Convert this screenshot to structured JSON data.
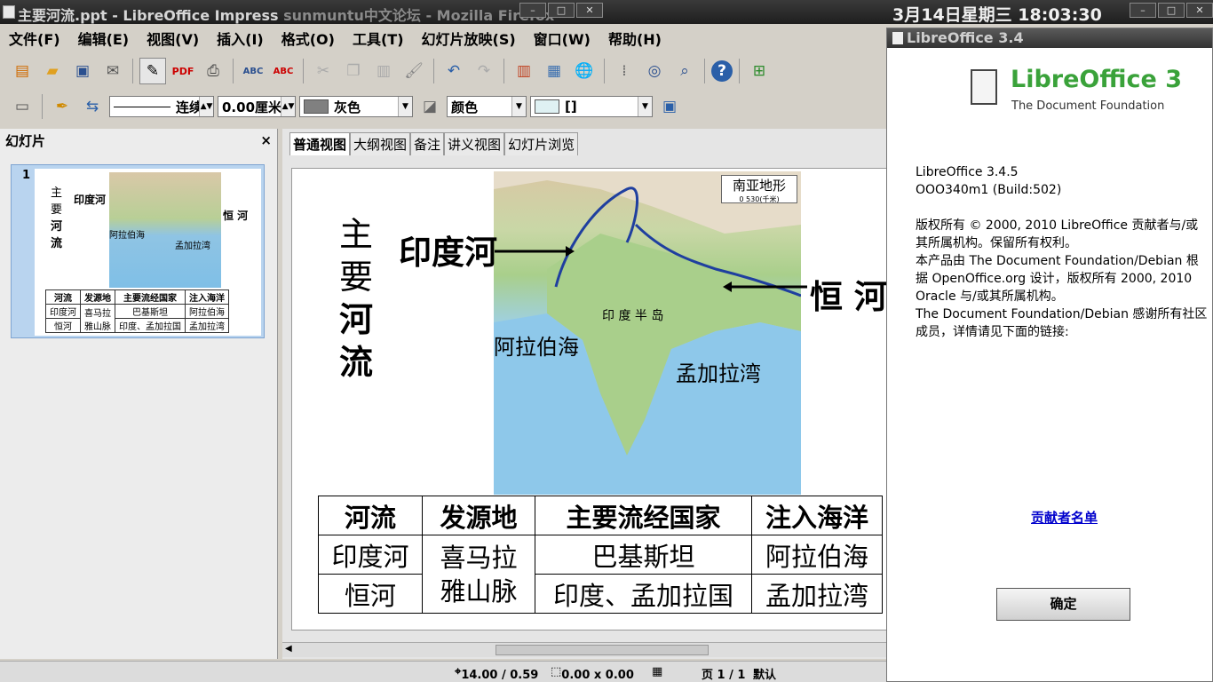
{
  "window": {
    "title": "主要河流.ppt - LibreOffice Impress",
    "browser_title": "sunmuntu中文论坛 - Mozilla Firefox",
    "clock": "3月14日星期三 18:03:30"
  },
  "menu": [
    "文件(F)",
    "编辑(E)",
    "视图(V)",
    "插入(I)",
    "格式(O)",
    "工具(T)",
    "幻灯片放映(S)",
    "窗口(W)",
    "帮助(H)"
  ],
  "toolbar2": {
    "line_style": "连续",
    "line_width": "0.00厘米",
    "line_color": "灰色",
    "area_style": "颜色",
    "area_fill": "[]"
  },
  "slides_pane": {
    "title": "幻灯片",
    "close": "×",
    "slide_number": "1"
  },
  "tabs": [
    "普通视图",
    "大纲视图",
    "备注",
    "讲义视图",
    "幻灯片浏览"
  ],
  "slide": {
    "title_chars": [
      "主",
      "要",
      "河",
      "流"
    ],
    "label_indus": "印度河",
    "label_ganges": "恒 河",
    "map_title": "南亚地形",
    "map_scale": "0      530(千米)",
    "map_arabian": "阿拉伯海",
    "map_bengal": "孟加拉湾",
    "map_peninsula": "印 度 半 岛",
    "table": {
      "headers": [
        "河流",
        "发源地",
        "主要流经国家",
        "注入海洋"
      ],
      "rows": [
        [
          "印度河",
          "喜马拉\n雅山脉",
          "巴基斯坦",
          "阿拉伯海"
        ],
        [
          "恒河",
          "",
          "印度、孟加拉国",
          "孟加拉湾"
        ]
      ]
    }
  },
  "status": {
    "position": "14.00 / 0.59",
    "size": "0.00 x 0.00",
    "page": "页 1 / 1",
    "layout": "默认"
  },
  "about": {
    "dialog_title": "LibreOffice 3.4",
    "brand": "LibreOffice 3",
    "foundation": "The Document Foundation",
    "version": "LibreOffice 3.4.5",
    "build": "OOO340m1 (Build:502)",
    "copyright": "版权所有 © 2000, 2010 LibreOffice 贡献者与/或其所属机构。保留所有权利。",
    "derived": "本产品由 The Document Foundation/Debian 根据 OpenOffice.org 设计，版权所有 2000, 2010 Oracle 与/或其所属机构。",
    "thanks": "The Document Foundation/Debian 感谢所有社区成员，详情请见下面的链接:",
    "credits_link": "贡献者名单",
    "ok": "确定"
  }
}
